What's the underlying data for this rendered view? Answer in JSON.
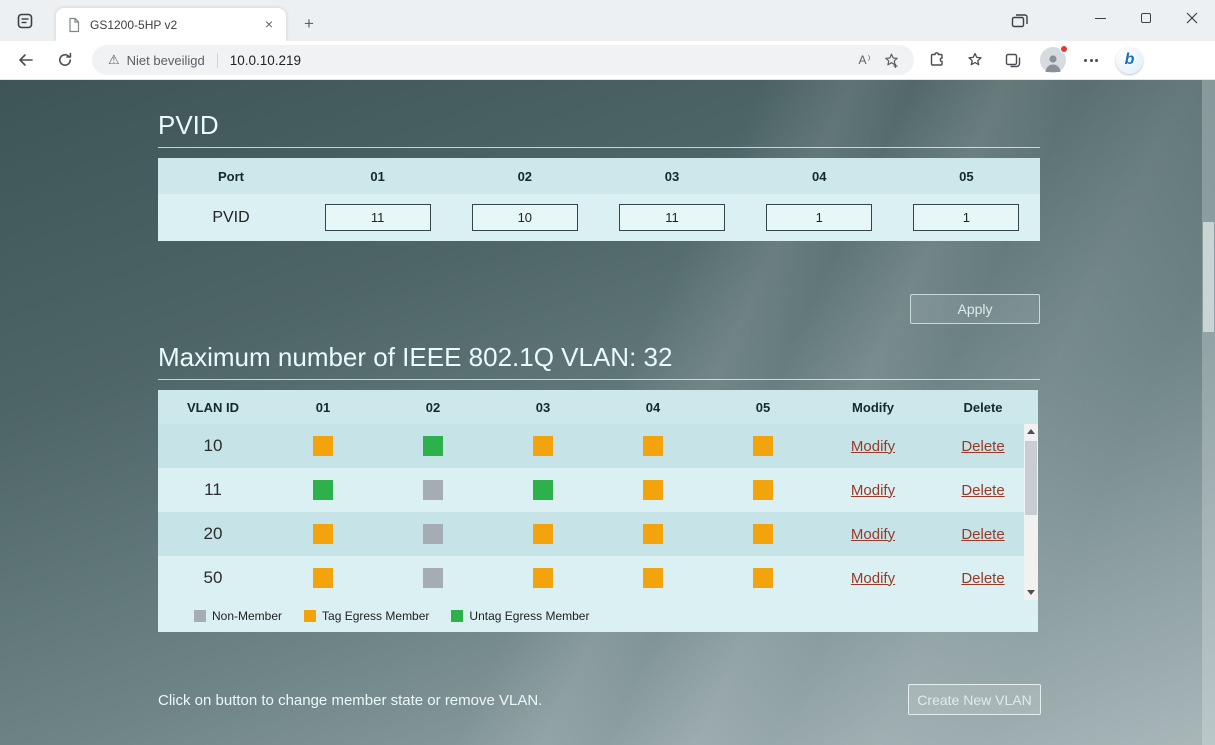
{
  "browser": {
    "tab_title": "GS1200-5HP v2",
    "new_tab_label": "+",
    "security_label": "Niet beveiligd",
    "url": "10.0.10.219",
    "read_aloud_label": "A⁾",
    "bing_label": "b"
  },
  "page": {
    "pvid": {
      "title": "PVID",
      "headers": [
        "Port",
        "01",
        "02",
        "03",
        "04",
        "05"
      ],
      "row_label": "PVID",
      "values": [
        "11",
        "10",
        "11",
        "1",
        "1"
      ],
      "apply_label": "Apply"
    },
    "vlan": {
      "title": "Maximum number of IEEE 802.1Q VLAN: 32",
      "headers": [
        "VLAN ID",
        "01",
        "02",
        "03",
        "04",
        "05",
        "Modify",
        "Delete"
      ],
      "rows": [
        {
          "id": "10",
          "members": [
            "tag",
            "untag",
            "tag",
            "tag",
            "tag"
          ],
          "modify": "Modify",
          "delete": "Delete"
        },
        {
          "id": "11",
          "members": [
            "untag",
            "non",
            "untag",
            "tag",
            "tag"
          ],
          "modify": "Modify",
          "delete": "Delete"
        },
        {
          "id": "20",
          "members": [
            "tag",
            "non",
            "tag",
            "tag",
            "tag"
          ],
          "modify": "Modify",
          "delete": "Delete"
        },
        {
          "id": "50",
          "members": [
            "tag",
            "non",
            "tag",
            "tag",
            "tag"
          ],
          "modify": "Modify",
          "delete": "Delete"
        }
      ],
      "legend": [
        {
          "state": "non",
          "label": "Non-Member"
        },
        {
          "state": "tag",
          "label": "Tag Egress Member"
        },
        {
          "state": "untag",
          "label": "Untag Egress Member"
        }
      ]
    },
    "hint": "Click on button to change member state or remove VLAN.",
    "create_vlan_label": "Create New VLAN",
    "colors": {
      "non_member": "#A6ACB4",
      "tag_member": "#F3A30B",
      "untag_member": "#2CB14B",
      "link": "#983A28",
      "table_header_bg": "#CDE8EB",
      "row_dark_bg": "#C6E3E7",
      "row_light_bg": "#DAF0F2",
      "title_text": "#E9FBFB"
    }
  }
}
